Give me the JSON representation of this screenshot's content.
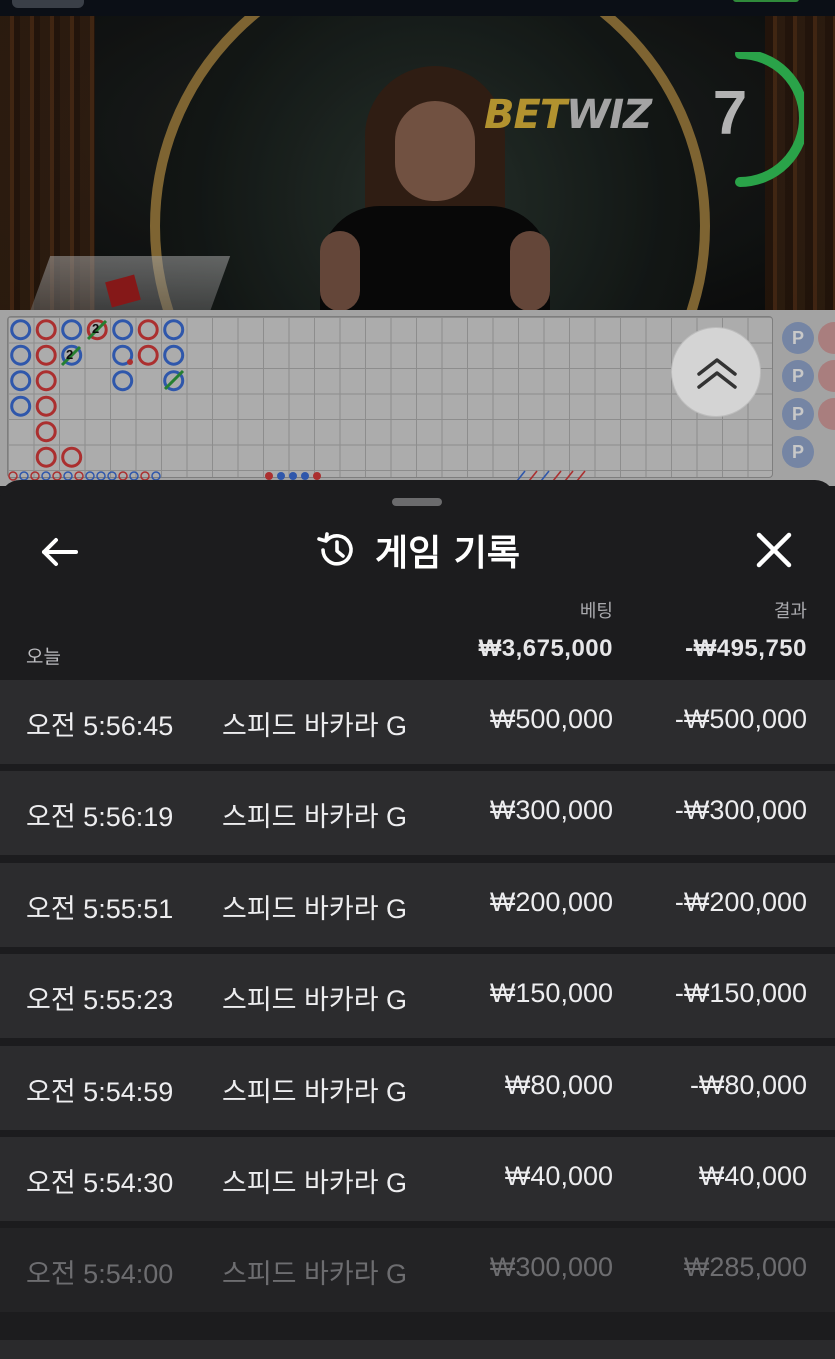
{
  "video": {
    "brand_part1": "BET",
    "brand_part2": "WIZ",
    "countdown": "7"
  },
  "side_column": {
    "player_marker": "P"
  },
  "bead_labels": {
    "a": "2",
    "b": "2"
  },
  "header": {
    "title": "게임 기록",
    "back_icon": "arrow-left-icon",
    "history_icon": "history-clock-icon",
    "close_icon": "close-x-icon"
  },
  "columns": {
    "bet": "베팅",
    "result": "결과"
  },
  "summary": {
    "label": "오늘",
    "total_bet": "₩3,675,000",
    "total_result": "-₩495,750"
  },
  "rows": [
    {
      "time": "오전 5:56:45",
      "game": "스피드 바카라 G",
      "bet": "₩500,000",
      "result": "-₩500,000"
    },
    {
      "time": "오전 5:56:19",
      "game": "스피드 바카라 G",
      "bet": "₩300,000",
      "result": "-₩300,000"
    },
    {
      "time": "오전 5:55:51",
      "game": "스피드 바카라 G",
      "bet": "₩200,000",
      "result": "-₩200,000"
    },
    {
      "time": "오전 5:55:23",
      "game": "스피드 바카라 G",
      "bet": "₩150,000",
      "result": "-₩150,000"
    },
    {
      "time": "오전 5:54:59",
      "game": "스피드 바카라 G",
      "bet": "₩80,000",
      "result": "-₩80,000"
    },
    {
      "time": "오전 5:54:30",
      "game": "스피드 바카라 G",
      "bet": "₩40,000",
      "result": "₩40,000"
    },
    {
      "time": "오전 5:54:00",
      "game": "스피드 바카라 G",
      "bet": "₩300,000",
      "result": "₩285,000"
    }
  ],
  "colors": {
    "sheet_bg": "#1c1c1e",
    "row_bg": "#2c2c2e",
    "player_blue": "#3a6bd1",
    "banker_red": "#d13a3a",
    "tie_green": "#2e9b3c",
    "timer_green": "#34c759"
  }
}
